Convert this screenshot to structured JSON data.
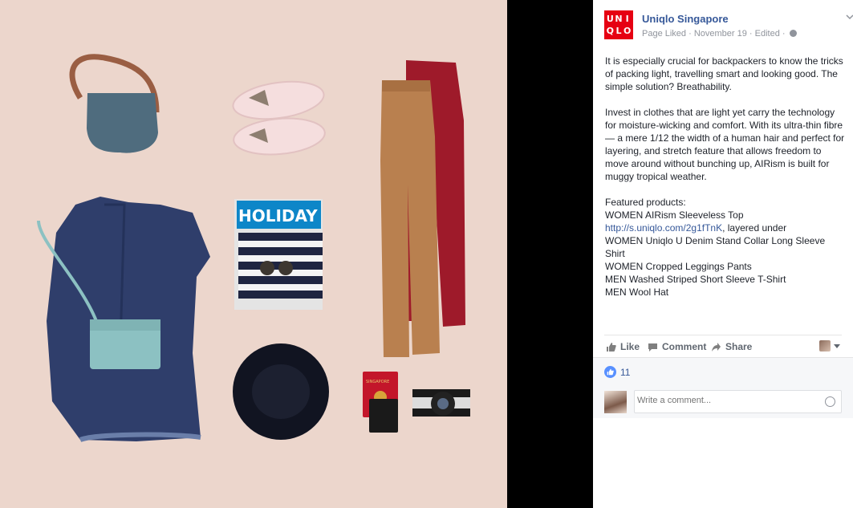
{
  "post": {
    "page_name": "Uniqlo Singapore",
    "logo_letters": [
      "U",
      "N",
      "I",
      "Q",
      "L",
      "O"
    ],
    "meta": "Page Liked · November 19 · Edited ·",
    "paragraph1": "It is especially crucial for backpackers to know the tricks of packing light, travelling smart and looking good. The simple solution? Breathability.",
    "paragraph2": "Invest in clothes that are light yet carry the technology for moisture-wicking and comfort. With its ultra-thin fibre — a mere 1/12 the width of a human hair and perfect for layering, and stretch feature that allows freedom to move around without bunching up, AIRism is built for muggy tropical weather.",
    "featured_heading": "Featured products:",
    "product1": "WOMEN AIRism Sleeveless Top",
    "product1_link": "http://s.uniqlo.com/2g1fTnK",
    "product1_suffix": ", layered under",
    "product2": "WOMEN Uniqlo U Denim Stand Collar Long Sleeve Shirt",
    "product3": "WOMEN Cropped Leggings Pants",
    "product4": "MEN Washed Striped Short Sleeve T-Shirt",
    "product5": "MEN Wool Hat"
  },
  "actions": {
    "like": "Like",
    "comment": "Comment",
    "share": "Share"
  },
  "reactions": {
    "count": "11"
  },
  "comment_box": {
    "placeholder": "Write a comment..."
  },
  "photo": {
    "magazine_title": "HOLIDAY",
    "passport_text": "SINGAPORE"
  },
  "colors": {
    "photo_bg": "#ecd6cc",
    "brand_red": "#e60012",
    "link_blue": "#365899",
    "like_blue": "#5890ff"
  }
}
